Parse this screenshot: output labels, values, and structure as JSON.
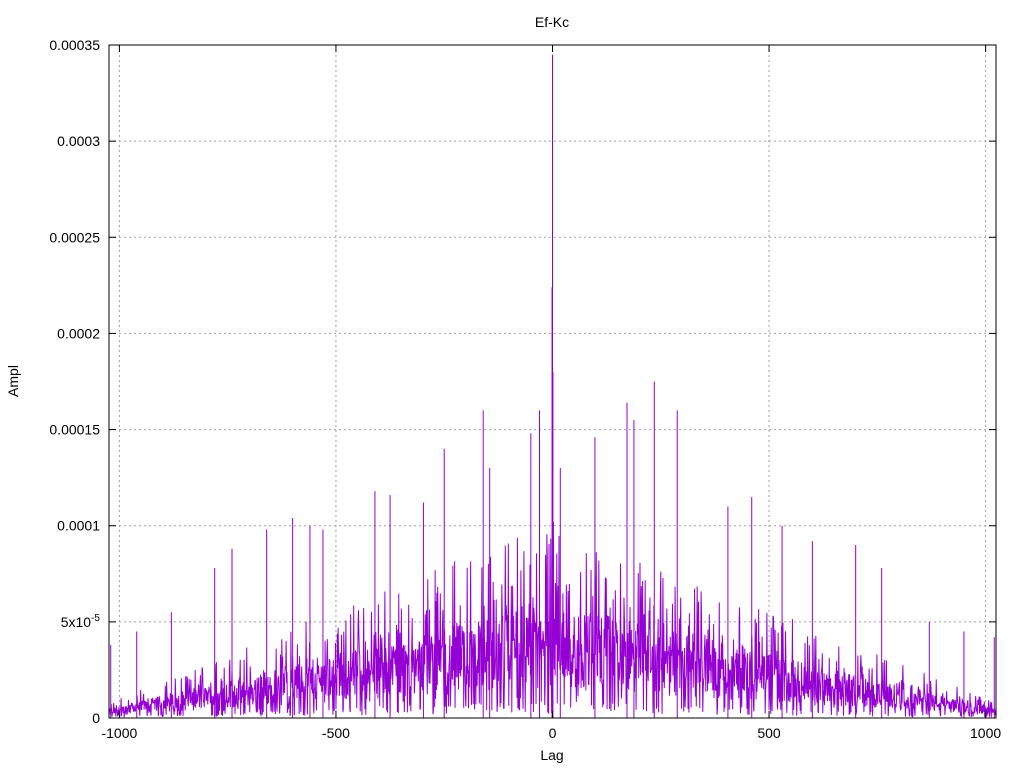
{
  "chart_data": {
    "type": "line",
    "title": "Ef-Kc",
    "xlabel": "Lag",
    "ylabel": "Ampl",
    "xlim": [
      -1024,
      1024
    ],
    "ylim": [
      0,
      0.00035
    ],
    "grid": true,
    "xticks": [
      {
        "value": -1000,
        "label": "-1000"
      },
      {
        "value": -500,
        "label": "-500"
      },
      {
        "value": 0,
        "label": "0"
      },
      {
        "value": 500,
        "label": "500"
      },
      {
        "value": 1000,
        "label": "1000"
      }
    ],
    "yticks": [
      {
        "value": 0,
        "label": "0"
      },
      {
        "value": 5e-05,
        "label": "5x10",
        "sup": "-5"
      },
      {
        "value": 0.0001,
        "label": "0.0001"
      },
      {
        "value": 0.00015,
        "label": "0.00015"
      },
      {
        "value": 0.0002,
        "label": "0.0002"
      },
      {
        "value": 0.00025,
        "label": "0.00025"
      },
      {
        "value": 0.0003,
        "label": "0.0003"
      },
      {
        "value": 0.00035,
        "label": "0.00035"
      }
    ],
    "series": [
      {
        "color": "#9400d3",
        "peaks": [
          {
            "x": 0,
            "y": 0.000345
          },
          {
            "x": -1,
            "y": 0.000224
          },
          {
            "x": 1,
            "y": 0.00018
          },
          {
            "x": 235,
            "y": 0.000175
          },
          {
            "x": 172,
            "y": 0.000164
          },
          {
            "x": -160,
            "y": 0.00016
          },
          {
            "x": -30,
            "y": 0.00016
          },
          {
            "x": 288,
            "y": 0.00016
          },
          {
            "x": 188,
            "y": 0.000155
          },
          {
            "x": -50,
            "y": 0.000148
          },
          {
            "x": 98,
            "y": 0.000146
          },
          {
            "x": -250,
            "y": 0.00014
          },
          {
            "x": -145,
            "y": 0.00013
          },
          {
            "x": 18,
            "y": 0.00013
          },
          {
            "x": -410,
            "y": 0.000118
          },
          {
            "x": -375,
            "y": 0.000116
          },
          {
            "x": -298,
            "y": 0.000112
          },
          {
            "x": 460,
            "y": 0.000115
          },
          {
            "x": -600,
            "y": 0.000104
          },
          {
            "x": 405,
            "y": 0.00011
          },
          {
            "x": -560,
            "y": 0.0001
          },
          {
            "x": -660,
            "y": 9.8e-05
          },
          {
            "x": -530,
            "y": 9.8e-05
          },
          {
            "x": 530,
            "y": 0.0001
          },
          {
            "x": 600,
            "y": 9.2e-05
          },
          {
            "x": -740,
            "y": 8.8e-05
          },
          {
            "x": 700,
            "y": 9e-05
          },
          {
            "x": 760,
            "y": 7.8e-05
          },
          {
            "x": -780,
            "y": 7.8e-05
          },
          {
            "x": -880,
            "y": 5.5e-05
          },
          {
            "x": 870,
            "y": 5e-05
          },
          {
            "x": -960,
            "y": 4.5e-05
          },
          {
            "x": 950,
            "y": 4.5e-05
          },
          {
            "x": -1020,
            "y": 3.8e-05
          },
          {
            "x": 1020,
            "y": 4.2e-05
          }
        ]
      }
    ]
  }
}
